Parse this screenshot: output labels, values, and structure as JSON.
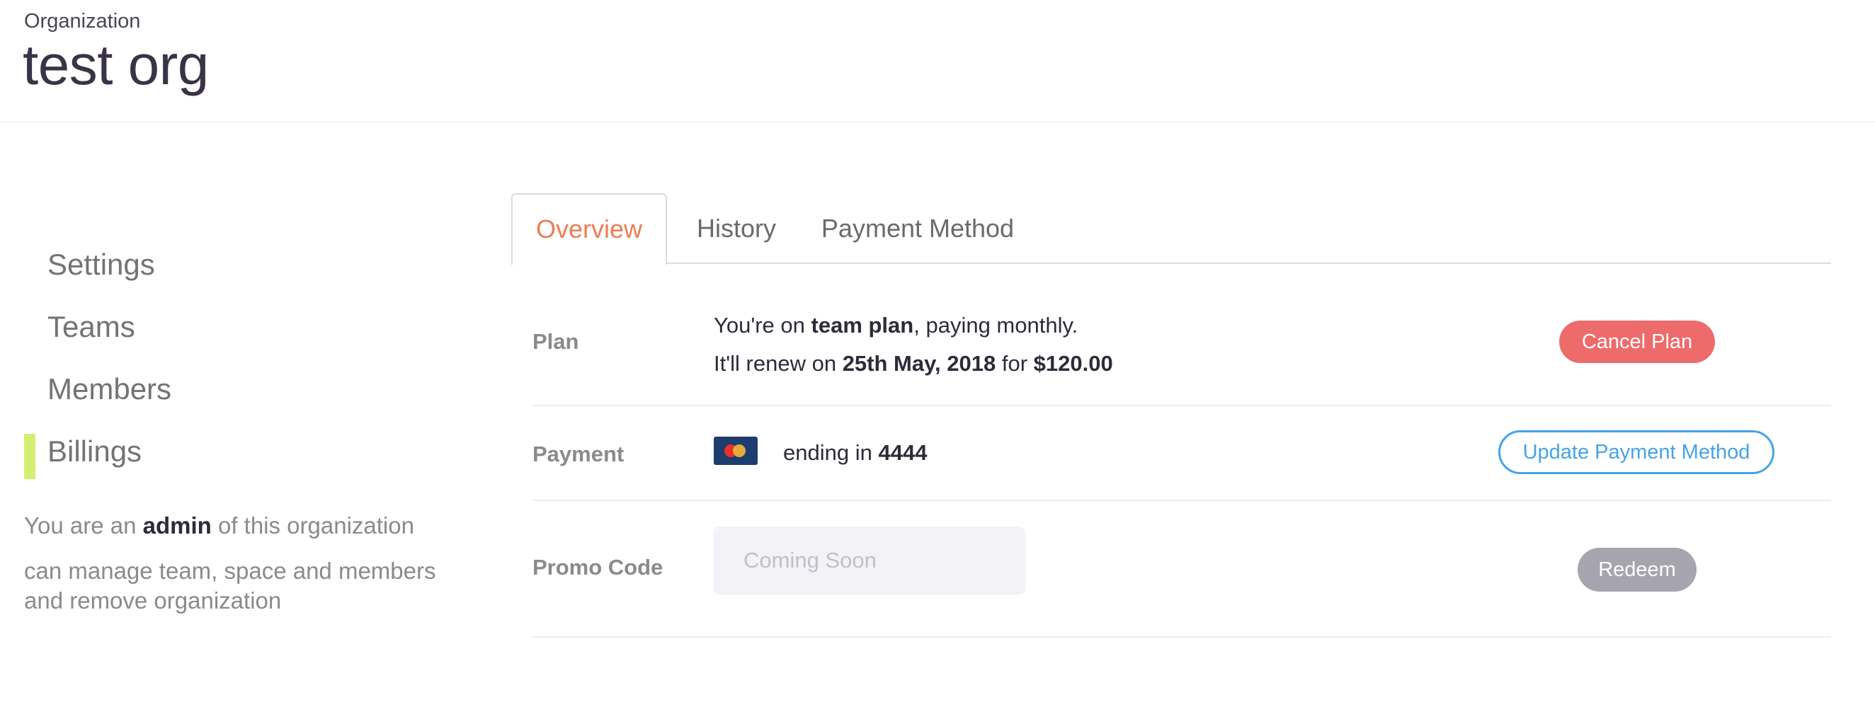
{
  "header": {
    "eyebrow": "Organization",
    "title": "test org"
  },
  "sidebar": {
    "items": [
      {
        "label": "Settings"
      },
      {
        "label": "Teams"
      },
      {
        "label": "Members"
      },
      {
        "label": "Billings",
        "active": true
      }
    ],
    "note": {
      "prefix": "You are an",
      "role": "admin",
      "suffix": "of this organization",
      "permissions_line1": "can manage team, space and members",
      "permissions_line2": "and remove organization"
    },
    "active_color": "#d4ee72"
  },
  "tabs": [
    {
      "label": "Overview",
      "active": true
    },
    {
      "label": "History"
    },
    {
      "label": "Payment Method"
    }
  ],
  "plan": {
    "label": "Plan",
    "line1_prefix": "You're on",
    "plan_name": "team plan",
    "line1_suffix": ", paying monthly.",
    "line2_prefix": "It'll renew on",
    "renew_date": "25th May, 2018",
    "line2_mid": "for",
    "amount": "$120.00",
    "cancel_label": "Cancel Plan"
  },
  "payment": {
    "label": "Payment",
    "card_icon": "mastercard-icon",
    "ending_prefix": "ending in",
    "last4": "4444",
    "update_label": "Update Payment Method"
  },
  "promo": {
    "label": "Promo Code",
    "placeholder": "Coming Soon",
    "value": "",
    "redeem_label": "Redeem"
  },
  "colors": {
    "accent_orange": "#ec7d53",
    "danger": "#ee6b6b",
    "link_blue": "#46a3e6",
    "disabled_gray": "#a6a4ae"
  }
}
